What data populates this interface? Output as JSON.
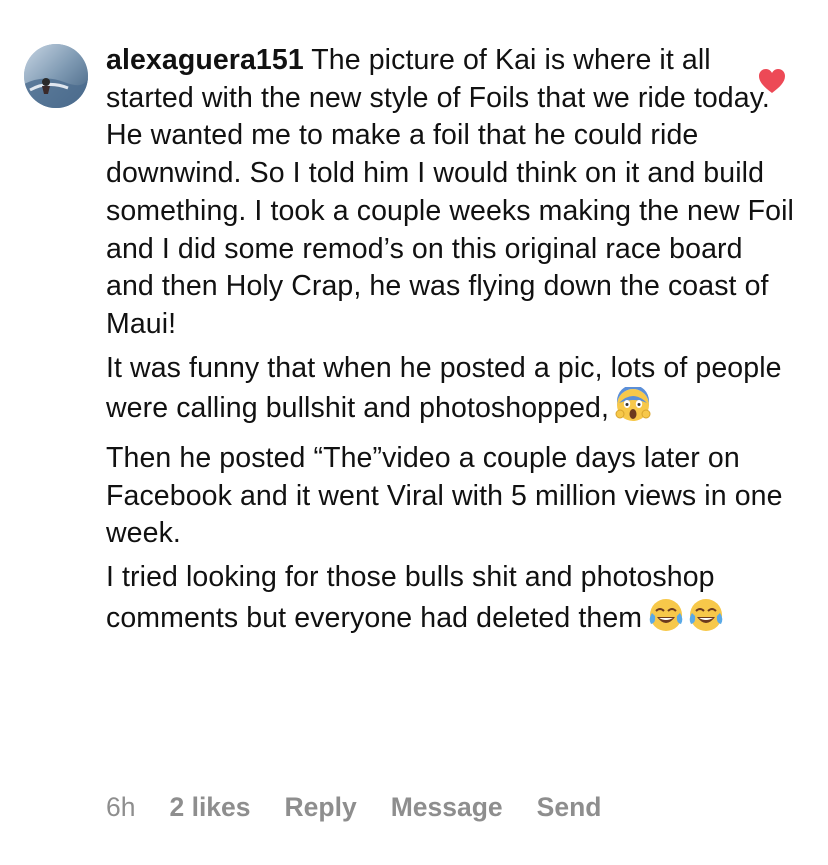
{
  "comment": {
    "username": "alexaguera151",
    "paragraphs": [
      {
        "lead": " The picture of Kai is where it all started with the new style of Foils that we ride today. He wanted me to make a foil that he could ride downwind. So I told him I would think on it and build something. I took a couple weeks making the new Foil and I did some remod’s on this original race board and then Holy Crap, he was flying down the coast of Maui!"
      },
      {
        "text": "It was funny that when he posted a pic, lots of people were calling bullshit and photoshopped,",
        "emoji": [
          "face-screaming-in-fear-emoji"
        ]
      },
      {
        "text": "Then he posted “The”video a couple days later on Facebook and it went Viral with 5 million views in one week."
      },
      {
        "text": "I tried looking for those bulls shit and photoshop comments but everyone had deleted them",
        "emoji": [
          "face-with-tears-of-joy-emoji",
          "face-with-tears-of-joy-emoji"
        ]
      }
    ],
    "liked": true,
    "accent_color": "#ed4956",
    "meta": {
      "time": "6h",
      "likes": "2 likes",
      "reply": "Reply",
      "message": "Message",
      "send": "Send"
    }
  }
}
